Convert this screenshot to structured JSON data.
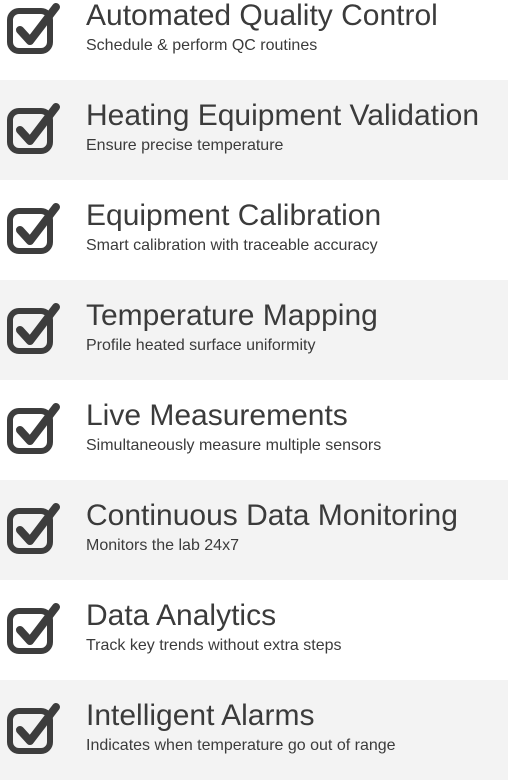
{
  "icon": "checkbox-checked-icon",
  "colors": {
    "text": "#3b3b3b",
    "icon": "#3d3d3d",
    "row_shaded": "#f3f3f3",
    "row_plain": "#ffffff"
  },
  "features": [
    {
      "title": "Automated Quality Control",
      "description": "Schedule & perform QC routines"
    },
    {
      "title": "Heating Equipment Validation",
      "description": "Ensure precise temperature"
    },
    {
      "title": "Equipment Calibration",
      "description": "Smart calibration with traceable accuracy"
    },
    {
      "title": "Temperature Mapping",
      "description": "Profile heated surface uniformity"
    },
    {
      "title": "Live Measurements",
      "description": "Simultaneously measure multiple sensors"
    },
    {
      "title": "Continuous Data Monitoring",
      "description": "Monitors the lab 24x7"
    },
    {
      "title": "Data Analytics",
      "description": "Track key trends without extra steps"
    },
    {
      "title": "Intelligent Alarms",
      "description": "Indicates when temperature go out of range"
    }
  ]
}
